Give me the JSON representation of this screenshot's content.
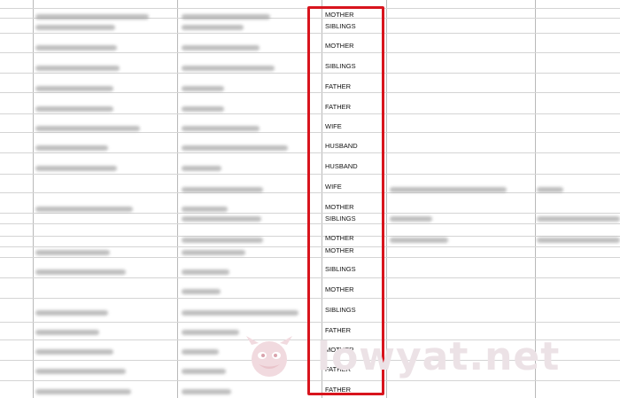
{
  "relationship_column": {
    "highlight_color": "#d8141d",
    "rows": [
      {
        "value": "MOTHER"
      },
      {
        "value": "SIBLINGS"
      },
      {
        "value": "MOTHER"
      },
      {
        "value": "SIBLINGS"
      },
      {
        "value": "FATHER"
      },
      {
        "value": "FATHER"
      },
      {
        "value": "WIFE"
      },
      {
        "value": "HUSBAND"
      },
      {
        "value": "HUSBAND"
      },
      {
        "value": "WIFE"
      },
      {
        "value": "MOTHER"
      },
      {
        "value": "SIBLINGS"
      },
      {
        "value": "MOTHER"
      },
      {
        "value": "MOTHER"
      },
      {
        "value": "SIBLINGS"
      },
      {
        "value": "MOTHER"
      },
      {
        "value": "SIBLINGS"
      },
      {
        "value": "FATHER"
      },
      {
        "value": "MOTHER"
      },
      {
        "value": "FATHER"
      },
      {
        "value": "FATHER"
      }
    ]
  },
  "watermark": {
    "text": "lowyat.net",
    "icon": "devil-mascot-icon"
  }
}
